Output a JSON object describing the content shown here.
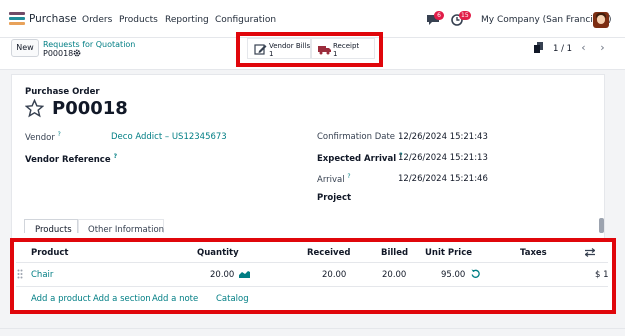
{
  "navbar": {
    "app_name": "Purchase",
    "menu": [
      "Orders",
      "Products",
      "Reporting",
      "Configuration"
    ],
    "chat_count": "6",
    "activity_count": "15",
    "company": "My Company (San Francisco)",
    "avatar_icon": "user-avatar"
  },
  "control": {
    "new_label": "New",
    "breadcrumb_parent": "Requests for Quotation",
    "breadcrumb_current": "P00018",
    "smart_buttons": [
      {
        "label": "Vendor Bills",
        "count": "1",
        "icon": "pencil-square-icon"
      },
      {
        "label": "Receipt",
        "count": "1",
        "icon": "truck-icon"
      }
    ],
    "pager": "1 / 1",
    "pager_prev": "‹",
    "pager_next": "›"
  },
  "form": {
    "doc_type": "Purchase Order",
    "doc_name": "P00018",
    "vendor_label": "Vendor",
    "vendor_value": "Deco Addict – US12345673",
    "vendor_ref_label": "Vendor Reference",
    "help_mark": "?",
    "confirmation_label": "Confirmation Date",
    "confirmation_value": "12/26/2024 15:21:43",
    "expected_label": "Expected Arrival",
    "expected_value": "12/26/2024 15:21:13",
    "arrival_label": "Arrival",
    "arrival_value": "12/26/2024 15:21:46",
    "project_label": "Project",
    "tabs": [
      "Products",
      "Other Information"
    ]
  },
  "lines": {
    "headers": {
      "product": "Product",
      "quantity": "Quantity",
      "received": "Received",
      "billed": "Billed",
      "unit_price": "Unit Price",
      "taxes": "Taxes"
    },
    "rows": [
      {
        "product": "Chair",
        "quantity": "20.00",
        "received": "20.00",
        "billed": "20.00",
        "unit_price": "95.00",
        "subtotal": "$ 1"
      }
    ],
    "add_product": "Add a product",
    "add_section": "Add a section",
    "add_note": "Add a note",
    "catalog": "Catalog"
  },
  "colors": {
    "accent": "#017e84",
    "highlight": "#e0060b",
    "badge": "#e11d48"
  }
}
